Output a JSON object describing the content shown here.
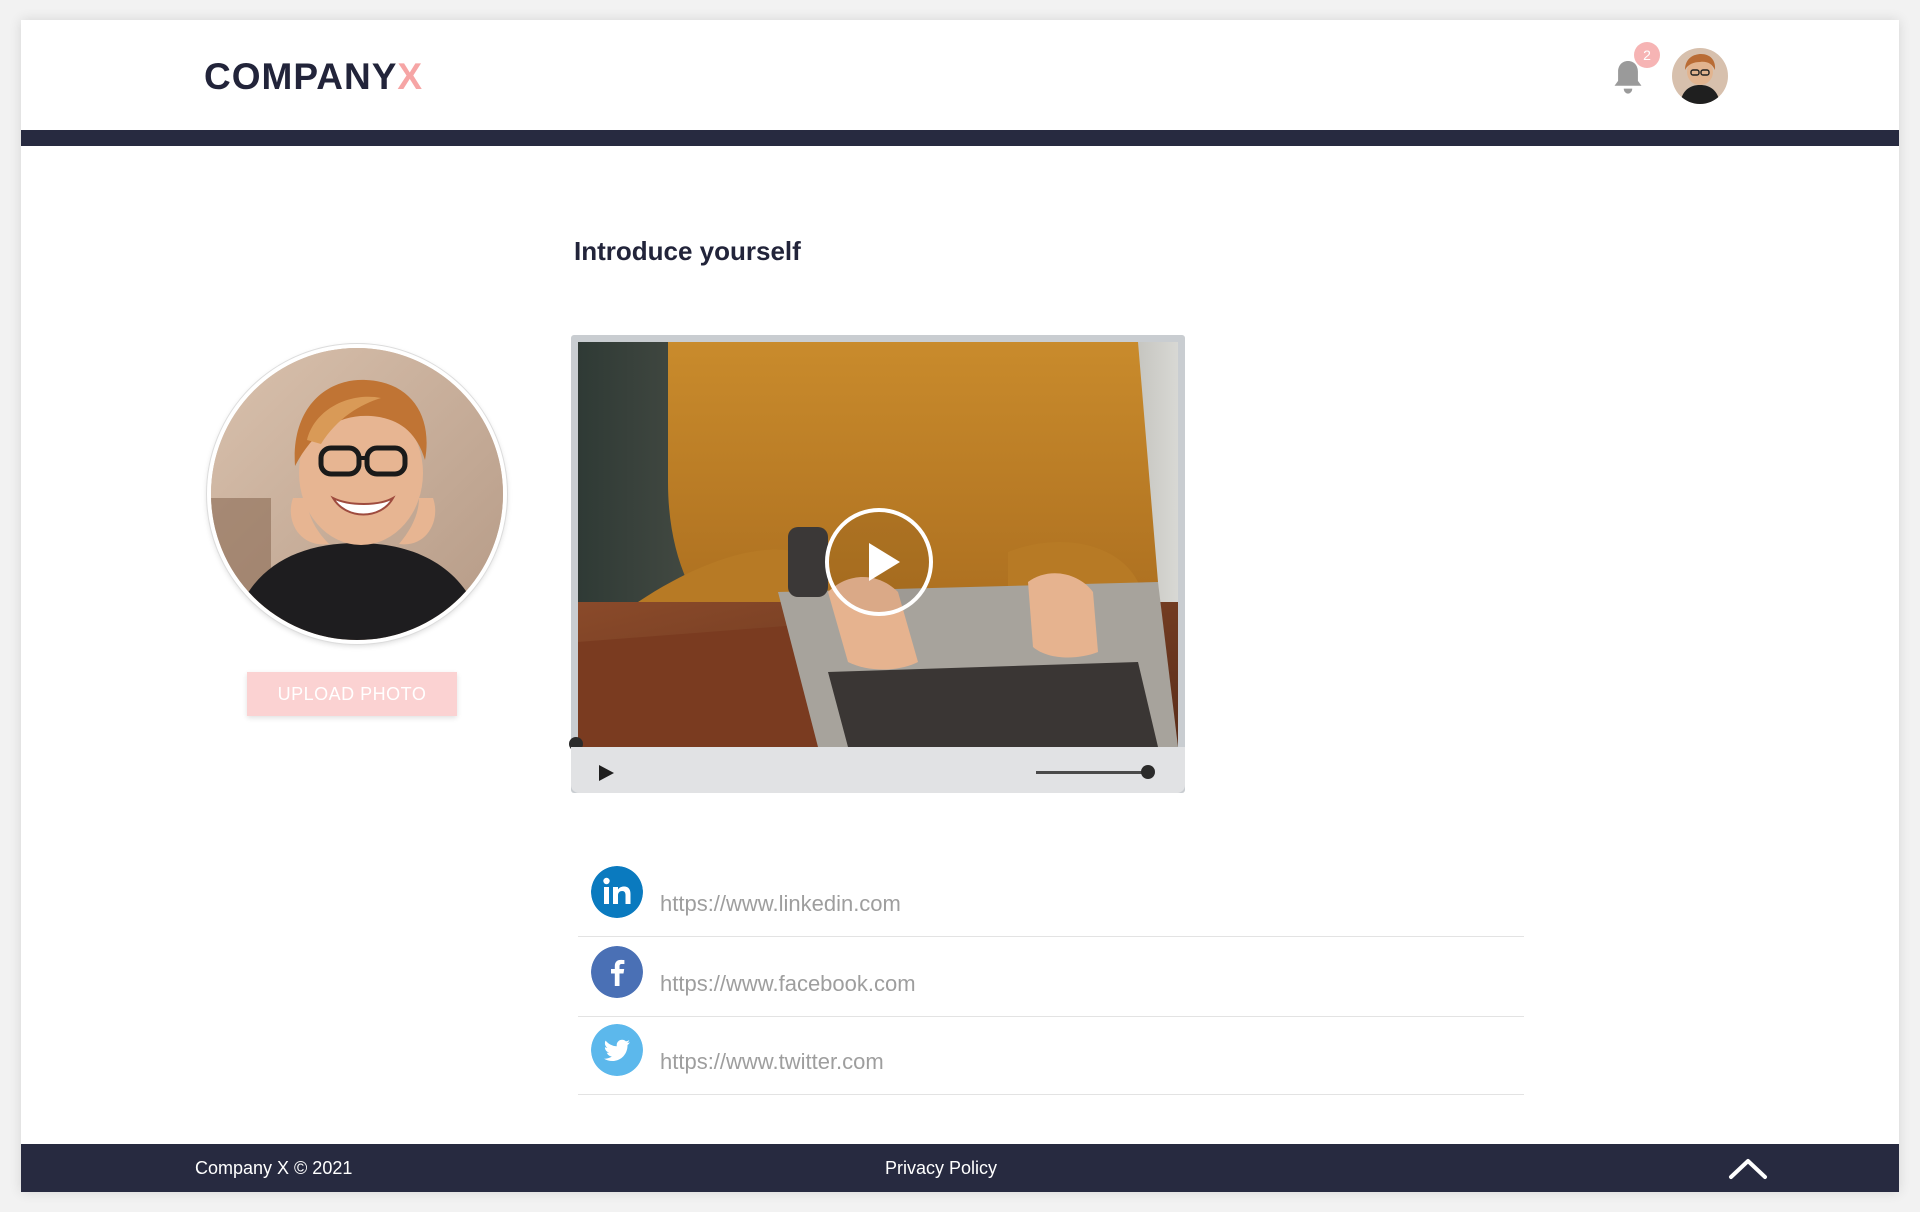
{
  "header": {
    "logo_main": "COMPANY",
    "logo_accent": "X",
    "notification_count": "2",
    "icons": {
      "bell": "bell-icon",
      "avatar": "user-avatar"
    }
  },
  "main": {
    "title": "Introduce yourself",
    "upload_button_label": "UPLOAD PHOTO",
    "video": {
      "icons": [
        "play-icon",
        "volume-slider"
      ],
      "progress_fraction": 0.0,
      "volume_fraction": 0.95
    },
    "social_links": [
      {
        "network": "linkedin",
        "icon": "linkedin-icon",
        "placeholder": "https://www.linkedin.com",
        "color": "#0a7abf"
      },
      {
        "network": "facebook",
        "icon": "facebook-icon",
        "placeholder": "https://www.facebook.com",
        "color": "#4a70b5"
      },
      {
        "network": "twitter",
        "icon": "twitter-icon",
        "placeholder": "https://www.twitter.com",
        "color": "#5cb8ec"
      }
    ]
  },
  "footer": {
    "copyright": "Company X © 2021",
    "privacy_label": "Privacy Policy",
    "icons": {
      "to_top": "chevron-up-icon"
    }
  },
  "colors": {
    "brand_dark": "#272a40",
    "brand_accent": "#f6a5a5",
    "upload_button": "#fbd2d2"
  }
}
